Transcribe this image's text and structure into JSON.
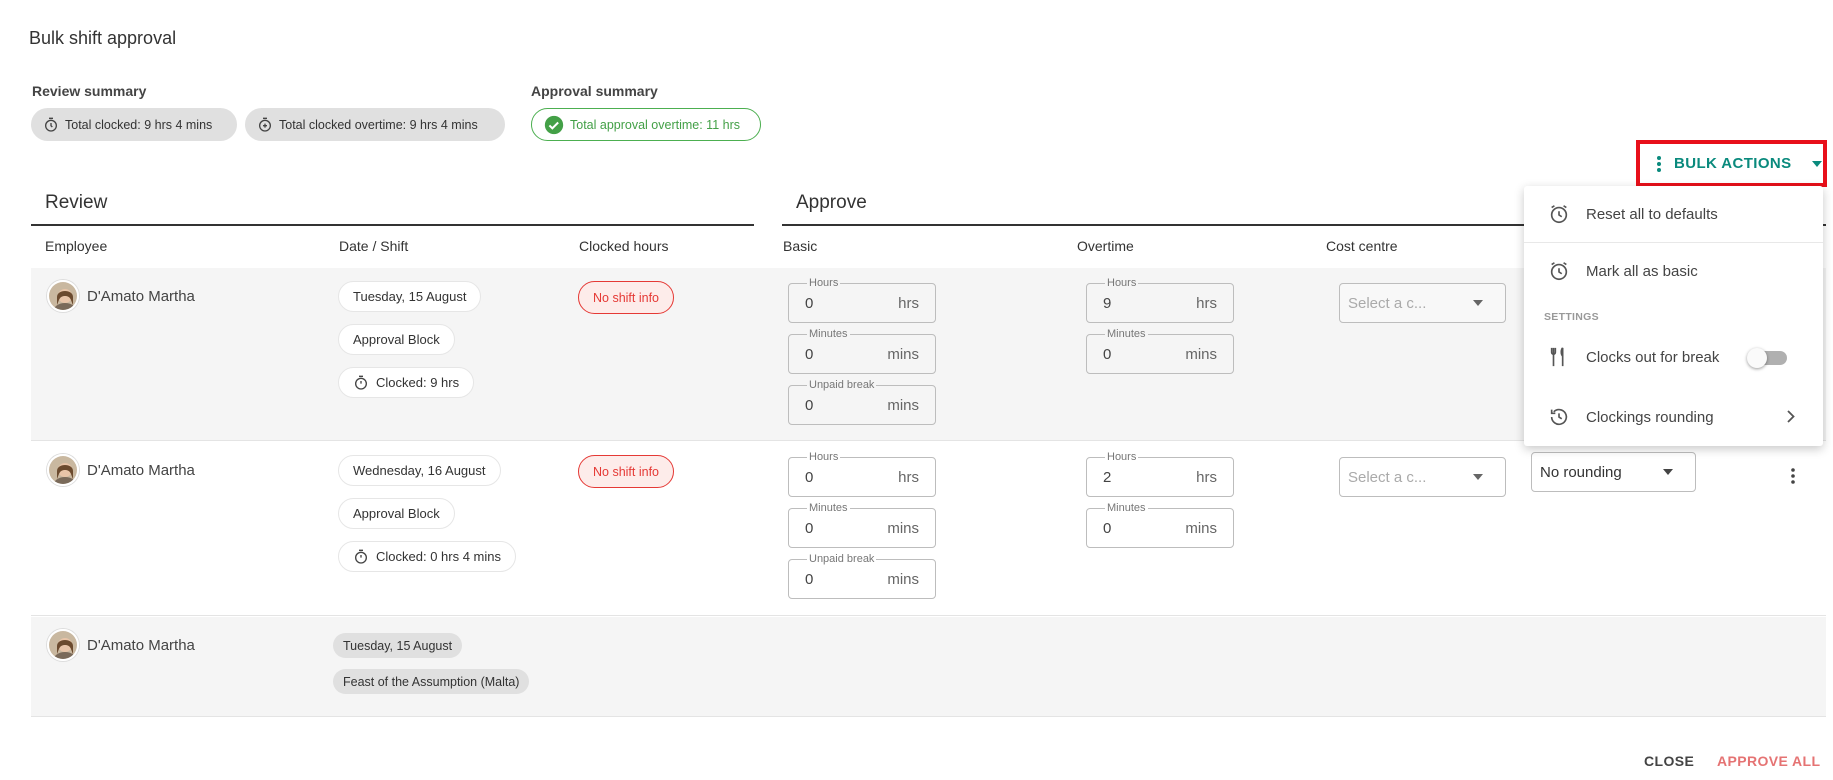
{
  "dialog": {
    "title": "Bulk shift approval"
  },
  "review_summary": {
    "label": "Review summary",
    "total_clocked": "Total clocked: 9 hrs 4 mins",
    "total_overtime": "Total clocked overtime: 9 hrs 4 mins"
  },
  "approval_summary": {
    "label": "Approval summary",
    "total_approval_overtime": "Total approval overtime: 11 hrs"
  },
  "bulk_actions": {
    "label": "BULK ACTIONS",
    "menu": {
      "reset": "Reset all to defaults",
      "mark_basic": "Mark all as basic",
      "settings_header": "SETTINGS",
      "clocks_out": "Clocks out for break",
      "clocks_out_enabled": false,
      "rounding": "Clockings rounding"
    }
  },
  "sections": {
    "review": "Review",
    "approve": "Approve"
  },
  "columns": {
    "employee": "Employee",
    "date_shift": "Date / Shift",
    "clocked_hours": "Clocked hours",
    "basic": "Basic",
    "overtime": "Overtime",
    "cost_centre": "Cost centre"
  },
  "field_labels": {
    "hours": "Hours",
    "minutes": "Minutes",
    "unpaid_break": "Unpaid break"
  },
  "units": {
    "hrs": "hrs",
    "mins": "mins"
  },
  "rows": [
    {
      "employee": "D'Amato Martha",
      "date": "Tuesday, 15 August",
      "block": "Approval Block",
      "clocked": "Clocked: 9 hrs",
      "status": "No shift info",
      "basic": {
        "hours": "0",
        "minutes": "0",
        "unpaid_break": "0"
      },
      "overtime": {
        "hours": "9",
        "minutes": "0"
      },
      "cost_centre_placeholder": "Select a c..."
    },
    {
      "employee": "D'Amato Martha",
      "date": "Wednesday, 16 August",
      "block": "Approval Block",
      "clocked": "Clocked: 0 hrs 4 mins",
      "status": "No shift info",
      "basic": {
        "hours": "0",
        "minutes": "0",
        "unpaid_break": "0"
      },
      "overtime": {
        "hours": "2",
        "minutes": "0"
      },
      "cost_centre_placeholder": "Select a c...",
      "rounding": "No rounding"
    },
    {
      "employee": "D'Amato Martha",
      "date": "Tuesday, 15 August",
      "holiday": "Feast of the Assumption (Malta)"
    }
  ],
  "footer": {
    "close": "CLOSE",
    "approve_all": "APPROVE ALL"
  },
  "colors": {
    "accent": "#0a8a7d",
    "danger": "#e53935",
    "success": "#43a047",
    "highlight": "#e8101a"
  },
  "icons": [
    "timer-icon",
    "timer-plus-icon",
    "check-circle-icon",
    "kebab-icon",
    "caret-down-icon",
    "alarm-icon",
    "cutlery-icon",
    "history-icon",
    "chevron-right-icon",
    "avatar"
  ]
}
